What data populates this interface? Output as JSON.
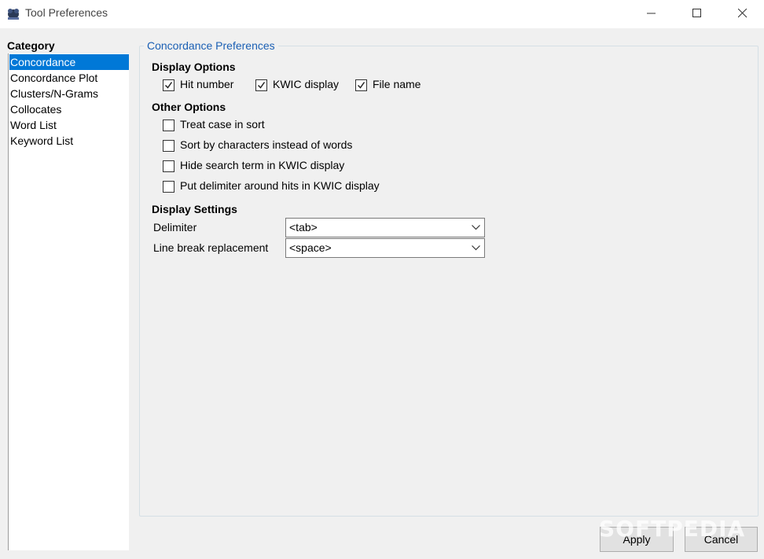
{
  "window": {
    "title": "Tool Preferences",
    "app_icon": "antconc-app-icon",
    "controls": [
      "minimize-icon",
      "maximize-icon",
      "close-icon"
    ]
  },
  "sidebar": {
    "label": "Category",
    "items": [
      {
        "label": "Concordance",
        "selected": true
      },
      {
        "label": "Concordance Plot",
        "selected": false
      },
      {
        "label": "Clusters/N-Grams",
        "selected": false
      },
      {
        "label": "Collocates",
        "selected": false
      },
      {
        "label": "Word List",
        "selected": false
      },
      {
        "label": "Keyword List",
        "selected": false
      }
    ],
    "selected_color": "#0078d7"
  },
  "panel": {
    "title": "Concordance Preferences",
    "title_color": "#1a5fb4",
    "display_options": {
      "heading": "Display Options",
      "items": [
        {
          "label": "Hit number",
          "checked": true
        },
        {
          "label": "KWIC display",
          "checked": true
        },
        {
          "label": "File name",
          "checked": true
        }
      ]
    },
    "other_options": {
      "heading": "Other Options",
      "items": [
        {
          "label": "Treat case in sort",
          "checked": false
        },
        {
          "label": "Sort by characters instead of words",
          "checked": false
        },
        {
          "label": "Hide search term in KWIC display",
          "checked": false
        },
        {
          "label": "Put delimiter around hits in KWIC display",
          "checked": false
        }
      ]
    },
    "display_settings": {
      "heading": "Display Settings",
      "delimiter": {
        "label": "Delimiter",
        "value": "<tab>"
      },
      "line_break": {
        "label": "Line break replacement",
        "value": "<space>"
      }
    }
  },
  "buttons": {
    "apply": "Apply",
    "cancel": "Cancel"
  },
  "watermark": "SOFTPEDIA"
}
